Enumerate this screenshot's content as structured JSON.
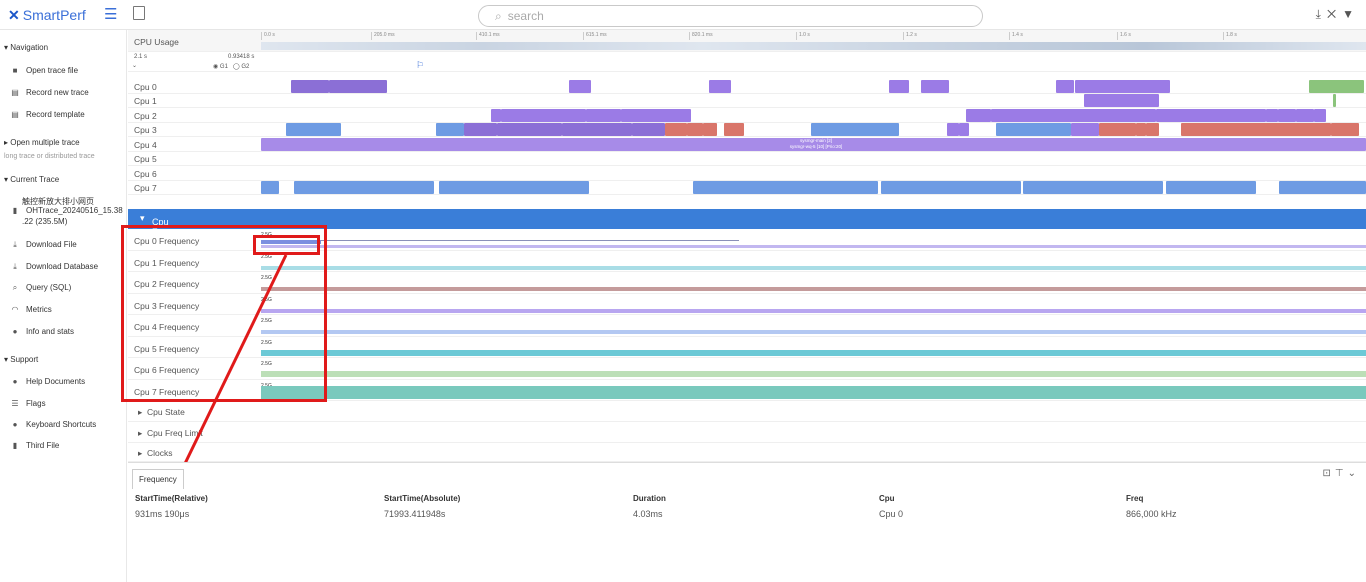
{
  "app": {
    "logo": "SmartPerf",
    "search_placeholder": "search"
  },
  "sidebar": {
    "navigation": "Navigation",
    "open_trace": "Open trace file",
    "record_new": "Record new trace",
    "record_template": "Record template",
    "open_multiple": "Open multiple trace",
    "long_trace": "long trace or distributed trace",
    "current_trace": "Current Trace",
    "trace_name_1": "触控新放大排小网页",
    "trace_name_2": "OHTrace_20240516_15.38",
    "trace_name_3": ".22 (235.5M)",
    "download_file": "Download File",
    "download_db": "Download Database",
    "query": "Query (SQL)",
    "metrics": "Metrics",
    "info": "Info and stats",
    "support": "Support",
    "help": "Help Documents",
    "flags": "Flags",
    "shortcuts": "Keyboard Shortcuts",
    "third": "Third File"
  },
  "tracks": {
    "cpu_usage": "CPU Usage",
    "range_left": "2.1 s",
    "range_right": "0.93418 s",
    "g1": "G1",
    "g2": "G2",
    "ruler": [
      "0.0 s",
      "205.0 ms",
      "410.1 ms",
      "615.1 ms",
      "820.1 ms",
      "1.0 s",
      "1.2 s",
      "1.4 s",
      "1.6 s",
      "1.8 s"
    ],
    "cpus": [
      "Cpu 0",
      "Cpu 1",
      "Cpu 2",
      "Cpu 3",
      "Cpu 4",
      "Cpu 5",
      "Cpu 6",
      "Cpu 7"
    ],
    "cpu_frequency": "Cpu Frequency",
    "freqs": [
      "Cpu 0 Frequency",
      "Cpu 1 Frequency",
      "Cpu 2 Frequency",
      "Cpu 3 Frequency",
      "Cpu 4 Frequency",
      "Cpu 5 Frequency",
      "Cpu 6 Frequency",
      "Cpu 7 Frequency"
    ],
    "freq_label": "2.5G",
    "cpu_state": "Cpu State",
    "cpu_freq_limit": "Cpu Freq Limit",
    "clocks": "Clocks",
    "cpu4_bar_1": "sysmgr-main [2]",
    "cpu4_bar_2": "sysmgr-wq-5 [10] [Prio:20]"
  },
  "bottom": {
    "tab": "Frequency",
    "headers": [
      "StartTime(Relative)",
      "StartTime(Absolute)",
      "Duration",
      "Cpu",
      "Freq"
    ],
    "row": [
      "931ms 190μs",
      "71993.411948s",
      "4.03ms",
      "Cpu 0",
      "866,000 kHz"
    ]
  },
  "colors": {
    "accent": "#3a7ed8",
    "annotation": "#e01a1a"
  }
}
